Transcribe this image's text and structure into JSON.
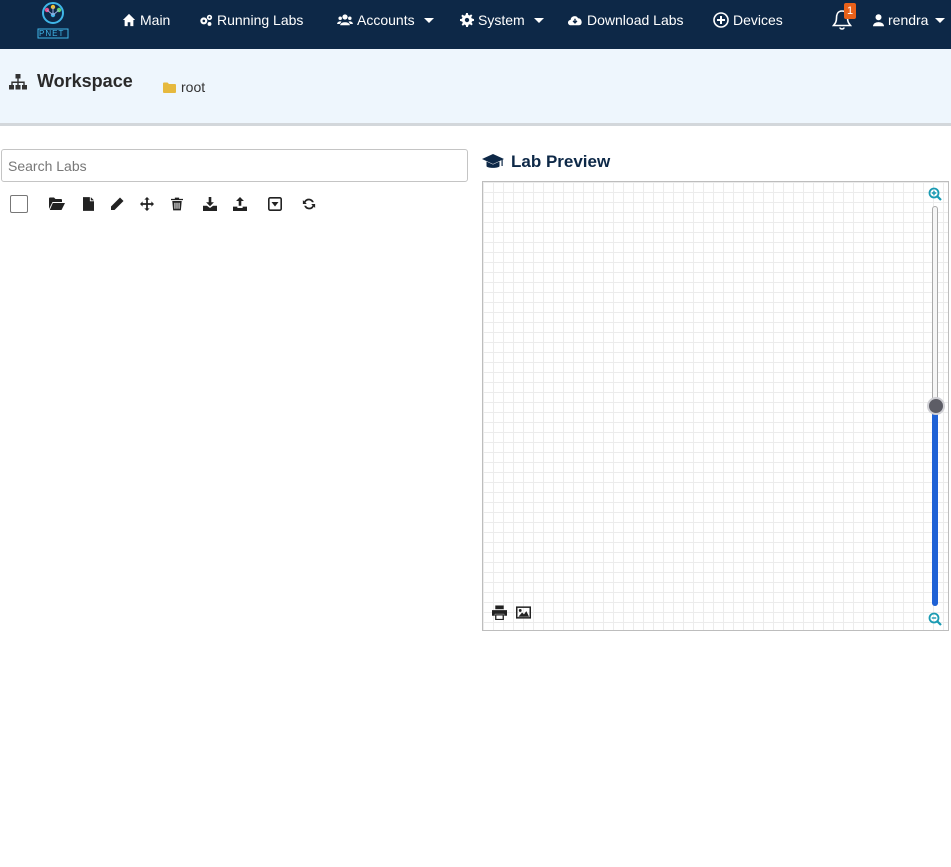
{
  "navbar": {
    "logo_text": "PNET",
    "items": [
      {
        "label": "Main",
        "icon": "home-icon"
      },
      {
        "label": "Running Labs",
        "icon": "gears-icon"
      },
      {
        "label": "Accounts",
        "icon": "users-icon"
      },
      {
        "label": "System",
        "icon": "gear-icon"
      },
      {
        "label": "Download Labs",
        "icon": "cloud-download-icon"
      },
      {
        "label": "Devices",
        "icon": "plus-circle-icon"
      }
    ],
    "notifications_count": "1",
    "user": "rendra"
  },
  "workspace": {
    "title": "Workspace",
    "breadcrumb": "root"
  },
  "left_panel": {
    "search_placeholder": "Search Labs",
    "toolbar_icons": [
      "folder-open-icon",
      "new-file-icon",
      "pencil-icon",
      "move-icon",
      "trash-icon",
      "import-icon",
      "export-icon",
      "select-dropdown-icon",
      "refresh-icon"
    ]
  },
  "lab_preview": {
    "title": "Lab Preview",
    "zoom_level_fraction": 0.5,
    "tools": [
      "print-icon",
      "image-icon"
    ],
    "colors": {
      "slider_fill": "#1f62d6",
      "zoom_icon": "#1a9bb3"
    }
  }
}
